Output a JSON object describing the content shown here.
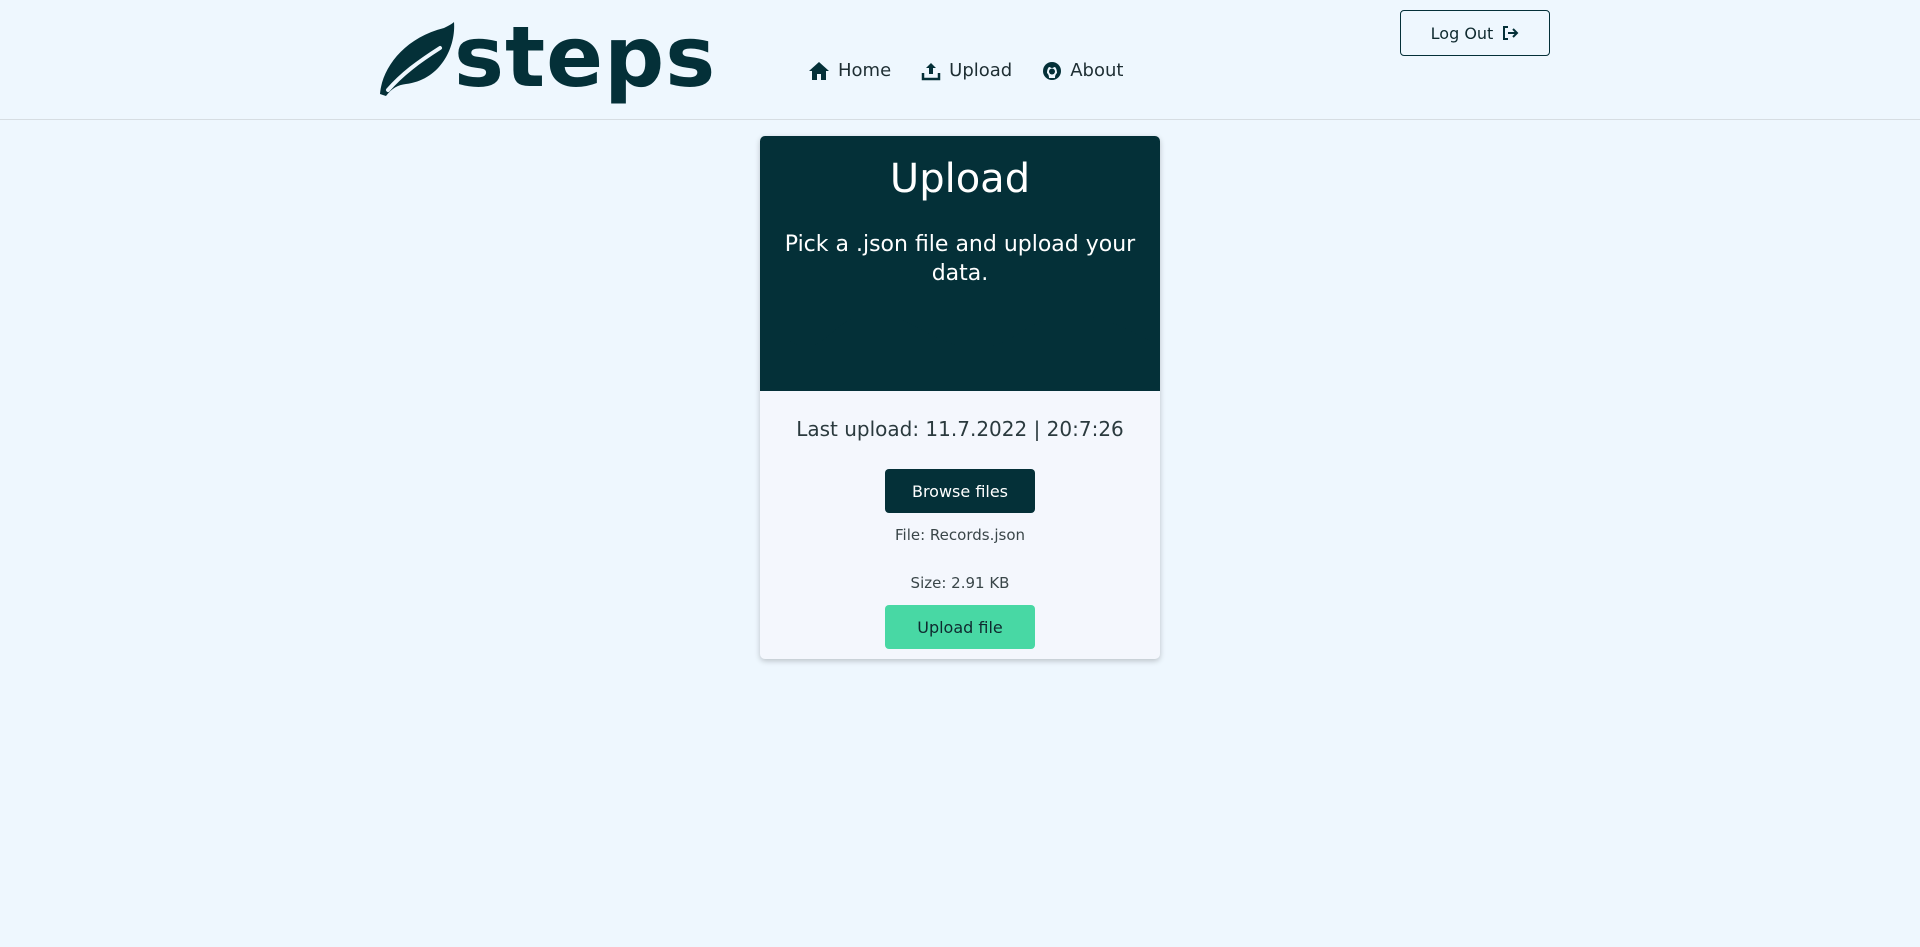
{
  "brand": {
    "name": "steps",
    "color": "#043038"
  },
  "nav": {
    "items": [
      {
        "label": "Home",
        "icon": "home-icon"
      },
      {
        "label": "Upload",
        "icon": "upload-icon"
      },
      {
        "label": "About",
        "icon": "github-icon"
      }
    ]
  },
  "header": {
    "logout_label": "Log Out",
    "logout_icon": "sign-out-icon"
  },
  "card": {
    "title": "Upload",
    "subtitle": "Pick a .json file and upload your data.",
    "last_upload": "Last upload: 11.7.2022 | 20:7:26",
    "browse_label": "Browse files",
    "file_label": "File: Records.json",
    "size_label": "Size: 2.91 KB",
    "upload_label": "Upload file"
  },
  "colors": {
    "page_bg": "#eef7fe",
    "dark": "#043038",
    "accent": "#48d8a4",
    "card_bg": "#f4f7fd"
  }
}
